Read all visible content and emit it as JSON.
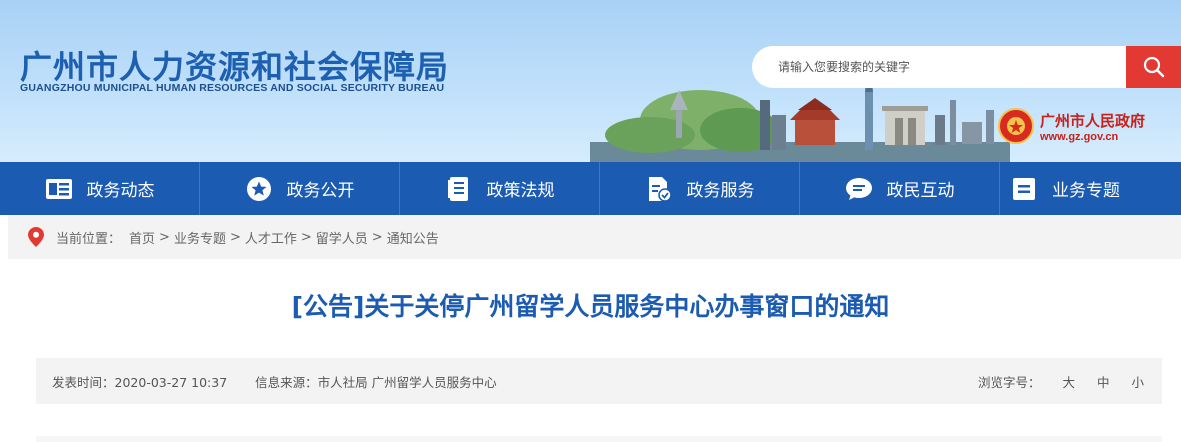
{
  "header": {
    "title": "广州市人力资源和社会保障局",
    "subtitle": "GUANGZHOU MUNICIPAL HUMAN RESOURCES AND SOCIAL SECURITY BUREAU",
    "search_placeholder": "请输入您要搜索的关键字",
    "gov_name": "广州市人民政府",
    "gov_url": "www.gz.gov.cn"
  },
  "nav": {
    "items": [
      {
        "label": "政务动态",
        "icon": "news-icon"
      },
      {
        "label": "政务公开",
        "icon": "star-icon"
      },
      {
        "label": "政策法规",
        "icon": "document-icon"
      },
      {
        "label": "政务服务",
        "icon": "service-doc-icon"
      },
      {
        "label": "政民互动",
        "icon": "chat-icon"
      },
      {
        "label": "业务专题",
        "icon": "topic-icon"
      }
    ]
  },
  "breadcrumb": {
    "label": "当前位置：",
    "items": [
      "首页",
      "业务专题",
      "人才工作",
      "留学人员",
      "通知公告"
    ],
    "separator": ">"
  },
  "article": {
    "title": "[公告]关于关停广州留学人员服务中心办事窗口的通知",
    "published_label": "发表时间：",
    "published_value": "2020-03-27 10:37",
    "source_label": "信息来源：",
    "source_value": "市人社局 广州留学人员服务中心",
    "font_size_label": "浏览字号：",
    "font_size_options": [
      "大",
      "中",
      "小"
    ]
  },
  "colors": {
    "brand_blue": "#1b5bb1",
    "search_red": "#e23a33",
    "gov_red": "#c8201a"
  }
}
